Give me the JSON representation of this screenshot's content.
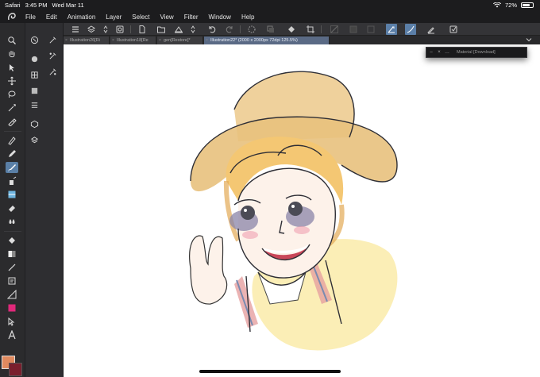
{
  "status_bar": {
    "app": "Safari",
    "time": "3:45 PM",
    "date": "Wed Mar 11",
    "battery": "72%",
    "battery_level": 0.72
  },
  "menu": {
    "items": [
      "File",
      "Edit",
      "Animation",
      "Layer",
      "Select",
      "View",
      "Filter",
      "Window",
      "Help"
    ]
  },
  "tabs": [
    {
      "label": "Illustration26[Ri"
    },
    {
      "label": "Illustration18[Re"
    },
    {
      "label": "gen[Restore]*"
    },
    {
      "label": "Illustration22* (2000 x 2000px 72dpi 125.5%)"
    }
  ],
  "material_panel": {
    "title": "Material [Download]"
  },
  "colors": {
    "main": "#e08a5f",
    "sub": "#7a1f2e",
    "accent": "#5a7fa6",
    "canvas": "#ffffff"
  }
}
